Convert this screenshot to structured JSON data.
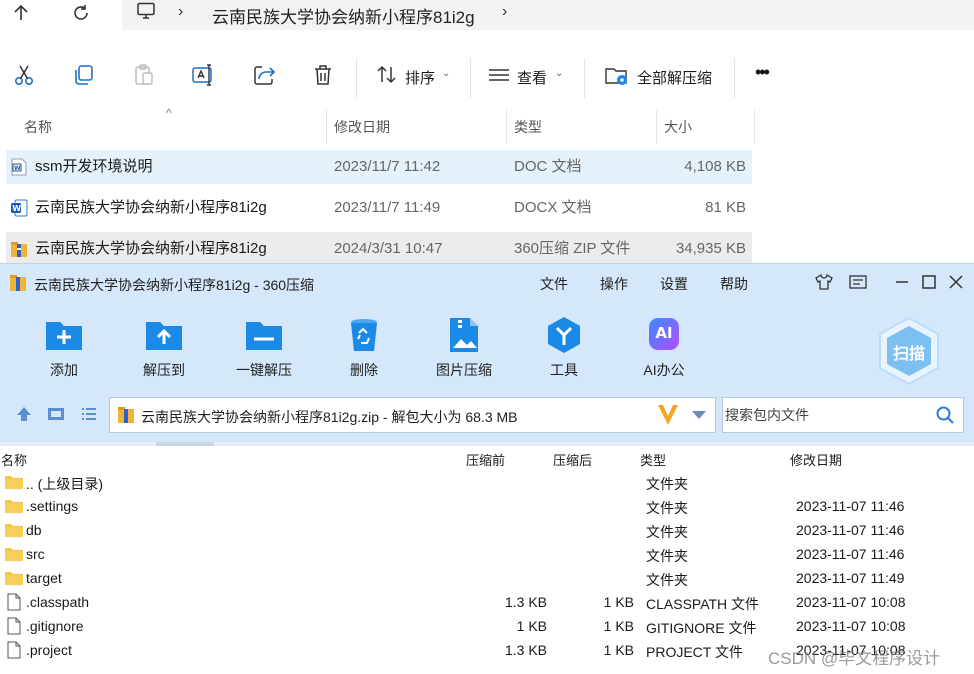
{
  "explorer": {
    "breadcrumb": "云南民族大学协会纳新小程序81i2g",
    "toolbar": {
      "sort_label": "排序",
      "view_label": "查看",
      "extract_all_label": "全部解压缩",
      "more_label": "•••"
    },
    "columns": {
      "name": "名称",
      "date": "修改日期",
      "type": "类型",
      "size": "大小"
    },
    "files": [
      {
        "name": "ssm开发环境说明",
        "date": "2023/11/7 11:42",
        "type": "DOC 文档",
        "size": "4,108 KB",
        "icon": "word-doc-icon"
      },
      {
        "name": "云南民族大学协会纳新小程序81i2g",
        "date": "2023/11/7 11:49",
        "type": "DOCX 文档",
        "size": "81 KB",
        "icon": "word-docx-icon"
      },
      {
        "name": "云南民族大学协会纳新小程序81i2g",
        "date": "2024/3/31 10:47",
        "type": "360压缩 ZIP 文件",
        "size": "34,935 KB",
        "icon": "zip-archive-icon"
      }
    ]
  },
  "zip": {
    "title": "云南民族大学协会纳新小程序81i2g - 360压缩",
    "menu": {
      "file": "文件",
      "ops": "操作",
      "settings": "设置",
      "help": "帮助"
    },
    "ribbon": {
      "add": "添加",
      "extract_to": "解压到",
      "one_click": "一键解压",
      "delete": "删除",
      "image_compress": "图片压缩",
      "tools": "工具",
      "ai_office": "AI办公",
      "ai_badge": "AI",
      "scan": "扫描"
    },
    "path": "云南民族大学协会纳新小程序81i2g.zip - 解包大小为 68.3 MB",
    "search_placeholder": "搜索包内文件",
    "columns": {
      "name": "名称",
      "before": "压缩前",
      "after": "压缩后",
      "type": "类型",
      "date": "修改日期"
    },
    "entries": [
      {
        "name": ".. (上级目录)",
        "before": "",
        "after": "",
        "type": "文件夹",
        "date": "",
        "kind": "folder"
      },
      {
        "name": ".settings",
        "before": "",
        "after": "",
        "type": "文件夹",
        "date": "2023-11-07 11:46",
        "kind": "folder"
      },
      {
        "name": "db",
        "before": "",
        "after": "",
        "type": "文件夹",
        "date": "2023-11-07 11:46",
        "kind": "folder"
      },
      {
        "name": "src",
        "before": "",
        "after": "",
        "type": "文件夹",
        "date": "2023-11-07 11:46",
        "kind": "folder"
      },
      {
        "name": "target",
        "before": "",
        "after": "",
        "type": "文件夹",
        "date": "2023-11-07 11:49",
        "kind": "folder"
      },
      {
        "name": ".classpath",
        "before": "1.3 KB",
        "after": "1 KB",
        "type": "CLASSPATH 文件",
        "date": "2023-11-07 10:08",
        "kind": "file"
      },
      {
        "name": ".gitignore",
        "before": "1 KB",
        "after": "1 KB",
        "type": "GITIGNORE 文件",
        "date": "2023-11-07 10:08",
        "kind": "file"
      },
      {
        "name": ".project",
        "before": "1.3 KB",
        "after": "1 KB",
        "type": "PROJECT 文件",
        "date": "2023-11-07 10:08",
        "kind": "file"
      }
    ]
  },
  "watermark": "CSDN @毕文程序设计",
  "colors": {
    "ribbon_bg": "#d4e7fb",
    "accent_blue": "#1a8ae6",
    "folder_yellow": "#f5c242",
    "selected_row": "#e5f1fb"
  }
}
